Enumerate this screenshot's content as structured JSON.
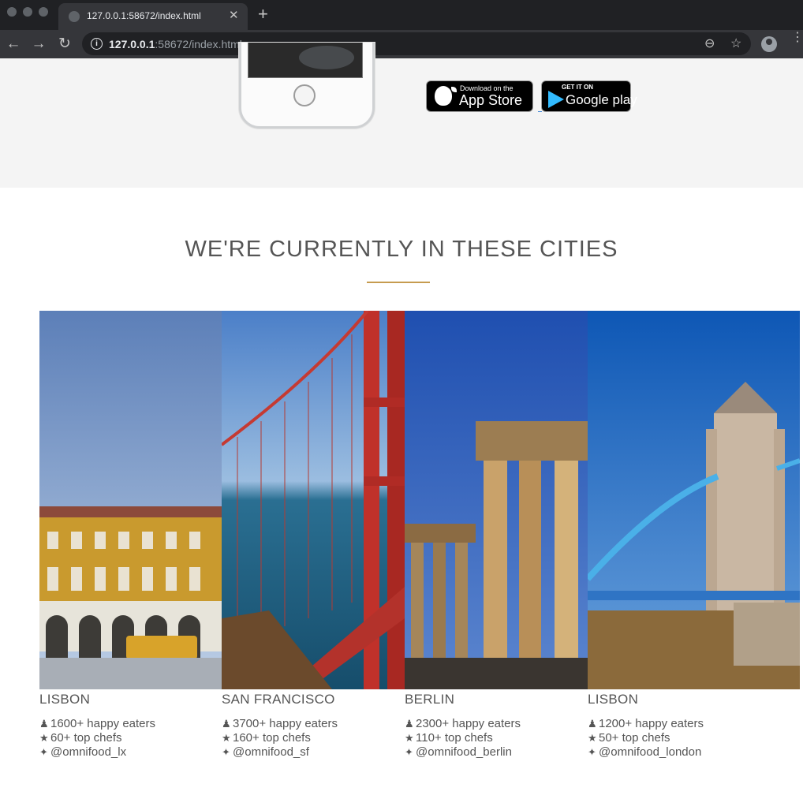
{
  "browser": {
    "tab_title": "127.0.0.1:58672/index.html",
    "tab_close": "✕",
    "new_tab": "+",
    "url_host": "127.0.0.1",
    "url_rest": ":58672/index.html",
    "nav_icons": {
      "back": "←",
      "forward": "→",
      "reload": "↻"
    },
    "icons": {
      "zoom": "⊖",
      "bookmark": "☆",
      "menu": "⋮"
    }
  },
  "app_badges": {
    "app_store_small": "Download on the",
    "app_store_large": "App Store",
    "google_small": "GET IT ON",
    "google_large": "Google play"
  },
  "section": {
    "title": "WE'RE CURRENTLY IN THESE CITIES"
  },
  "cities": [
    {
      "name": "LISBON",
      "eaters": "1600+ happy eaters",
      "chefs": "60+ top chefs",
      "twitter": "@omnifood_lx"
    },
    {
      "name": "SAN FRANCISCO",
      "eaters": "3700+ happy eaters",
      "chefs": "160+ top chefs",
      "twitter": "@omnifood_sf"
    },
    {
      "name": "BERLIN",
      "eaters": "2300+ happy eaters",
      "chefs": "110+ top chefs",
      "twitter": "@omnifood_berlin"
    },
    {
      "name": "LISBON",
      "eaters": "1200+ happy eaters",
      "chefs": "50+ top chefs",
      "twitter": "@omnifood_london"
    }
  ],
  "stat_icons": {
    "person": "👤",
    "star": "★",
    "twitter": "🐦"
  },
  "colors": {
    "accent": "#c69b4f",
    "text": "#555555",
    "section_bg": "#f4f4f4"
  }
}
